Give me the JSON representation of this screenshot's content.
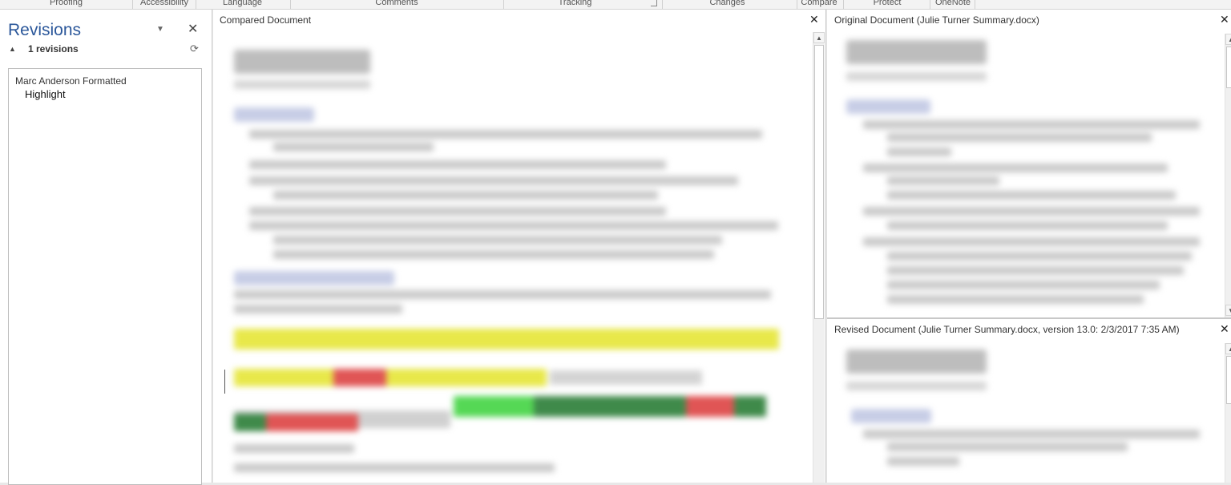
{
  "ribbon_groups": [
    "Proofing",
    "Accessibility",
    "Language",
    "Comments",
    "Tracking",
    "Changes",
    "Compare",
    "Protect",
    "OneNote"
  ],
  "revisions_pane": {
    "title": "Revisions",
    "count_label": "1 revisions",
    "items": [
      {
        "author_action": "Marc Anderson Formatted",
        "type": "Highlight"
      }
    ]
  },
  "compared_document": {
    "title": "Compared Document",
    "close_icon": "close-icon"
  },
  "original_document": {
    "title": "Original Document (Julie Turner Summary.docx)",
    "close_icon": "close-icon"
  },
  "revised_document": {
    "title": "Revised Document (Julie Turner Summary.docx, version 13.0: 2/3/2017 7:35 AM)",
    "close_icon": "close-icon"
  },
  "colors": {
    "accent": "#2b579a",
    "highlight_yellow": "#e8e84a",
    "deletion_red": "#e05555",
    "insertion_green": "#55d855",
    "dark_green": "#3f8a4a"
  }
}
